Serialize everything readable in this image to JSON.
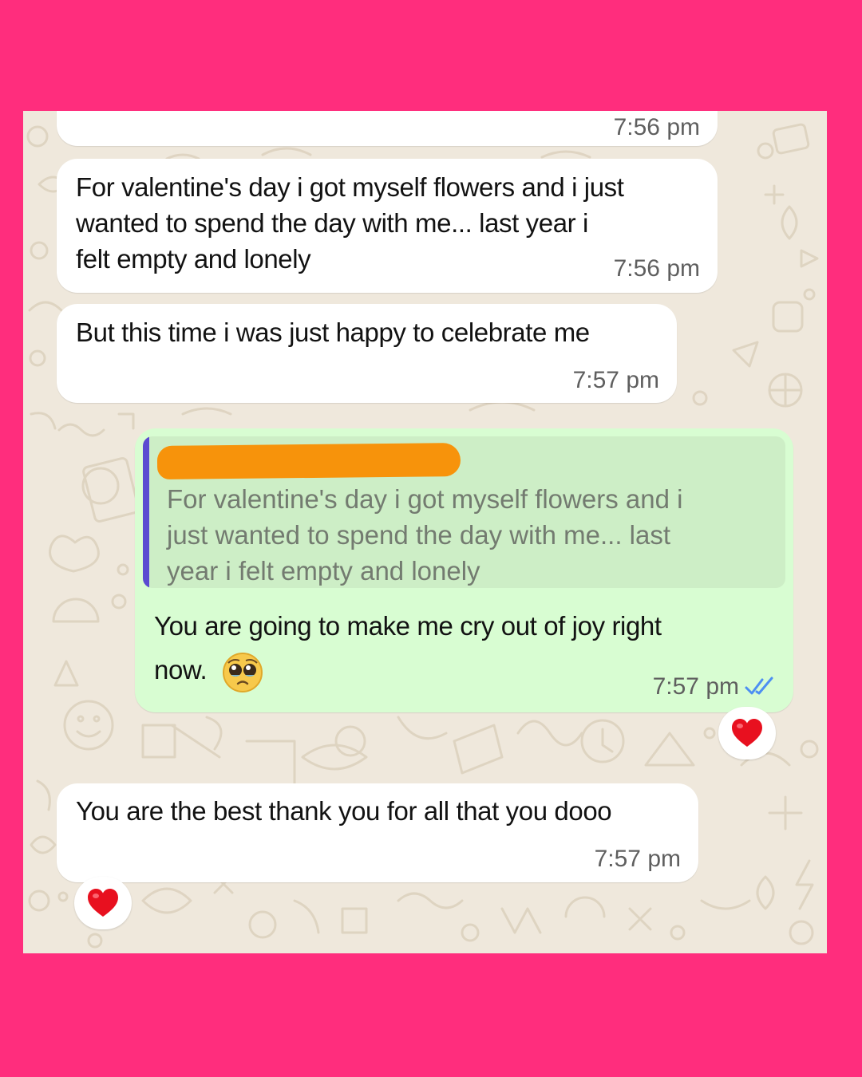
{
  "page": {
    "background_color": "#ff2d7d",
    "screenshot_background": "#efe8dc"
  },
  "chat": {
    "messages": [
      {
        "direction": "incoming",
        "lines": [],
        "time": "7:56 pm"
      },
      {
        "direction": "incoming",
        "lines": [
          "For valentine's day i got myself flowers and i just",
          "wanted to spend the day with me... last year i",
          "felt empty and lonely"
        ],
        "time": "7:56 pm"
      },
      {
        "direction": "incoming",
        "lines": [
          "But this time i was just happy to celebrate me"
        ],
        "time": "7:57 pm"
      },
      {
        "direction": "outgoing",
        "quote": {
          "sender_redacted": true,
          "redaction_color": "#f7930b",
          "accent_color": "#5b4bd1",
          "lines": [
            "For valentine's day i got myself flowers and i",
            "just wanted to spend the day with me... last",
            "year i felt empty and lonely"
          ]
        },
        "lines": [
          "You are going to make me cry out of joy right",
          "now."
        ],
        "emoji_icon": "pleading-face-icon",
        "time": "7:57 pm",
        "status_icon": "double-check-icon",
        "status_color": "#4d8ff2",
        "reaction_icon": "red-heart-icon"
      },
      {
        "direction": "incoming",
        "lines": [
          "You are the best thank you for all that you dooo"
        ],
        "time": "7:57 pm",
        "reaction_icon": "red-heart-icon"
      }
    ],
    "bubble_colors": {
      "incoming": "#ffffff",
      "outgoing": "#d8fdd2"
    },
    "reaction_color": "#e8101f"
  }
}
